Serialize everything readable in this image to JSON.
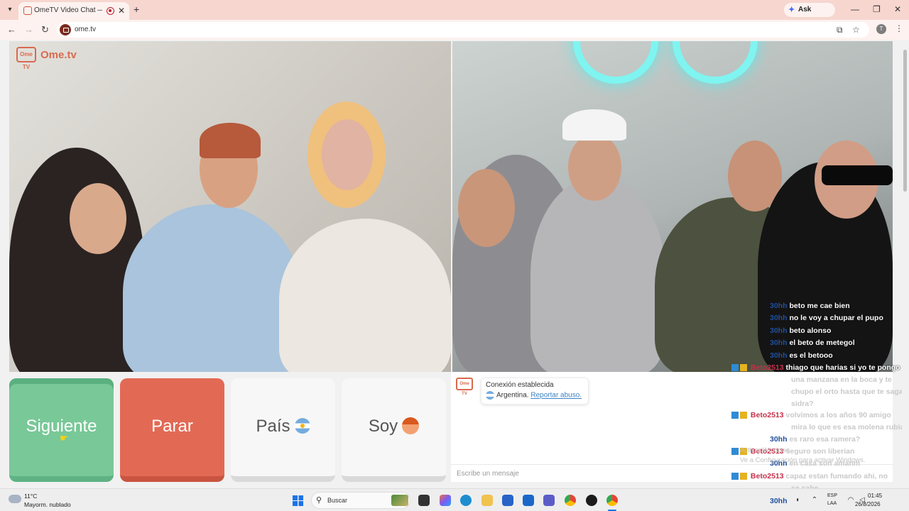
{
  "browser": {
    "tab_title": "OmeTV Video Chat — Ome",
    "ask_gemini": "Ask Gemini",
    "url": "ome.tv",
    "profile_initial": "T",
    "icons": [
      "tab-search-icon",
      "close-icon",
      "plus-icon",
      "minimize-icon",
      "restore-icon",
      "back-icon",
      "forward-icon",
      "reload-icon",
      "install-icon",
      "star-icon",
      "more-icon"
    ]
  },
  "site": {
    "logo_badge": "Ome TV",
    "logo_text": "Ome.tv"
  },
  "buttons": {
    "next": "Siguiente",
    "stop": "Parar",
    "country": "País",
    "gender": "Soy"
  },
  "chat": {
    "status": "Conexión establecida",
    "country": "Argentina.",
    "report": "Reportar abuso.",
    "input_placeholder": "Escribe un mensaje"
  },
  "overlay_chat": [
    {
      "user": "30hh",
      "text": "beto me cae bien"
    },
    {
      "user": "30hh",
      "text": "no le voy a chupar el pupo"
    },
    {
      "user": "30hh",
      "text": "beto alonso"
    },
    {
      "user": "30hh",
      "text": "el beto de metegol"
    },
    {
      "user": "30hh",
      "text": "es el betooo"
    },
    {
      "user": "Beto2513",
      "text": "thiago que harias si yo te pongo"
    },
    {
      "user": "",
      "text": "una manzana en la boca y te"
    },
    {
      "user": "",
      "text": "chupo el orto hasta que te saga"
    },
    {
      "user": "",
      "text": "sidra?"
    },
    {
      "user": "Beto2513",
      "text": "volvimos a los años 90 amigo"
    },
    {
      "user": "",
      "text": "mira lo que es esa molena rubia"
    },
    {
      "user": "30hh",
      "text": "es raro esa ramera?"
    },
    {
      "user": "Beto2513",
      "text": "seguro son liberian"
    },
    {
      "user": "30hh",
      "text": "en casa son amanm"
    },
    {
      "user": "Beto2513",
      "text": "capaz estan fumando ahi, no"
    },
    {
      "user": "",
      "text": "se sabe"
    }
  ],
  "windows_notice": {
    "line1": "Activar Windows",
    "line2": "Ve a Configuración para activar Windows."
  },
  "taskbar": {
    "temp": "11°C",
    "weather": "Mayorm. nublado",
    "search": "Buscar",
    "user_tag": "30hh",
    "lang1": "ESP",
    "lang2": "LAA",
    "time": "01:45",
    "date": "26/8/2026"
  }
}
